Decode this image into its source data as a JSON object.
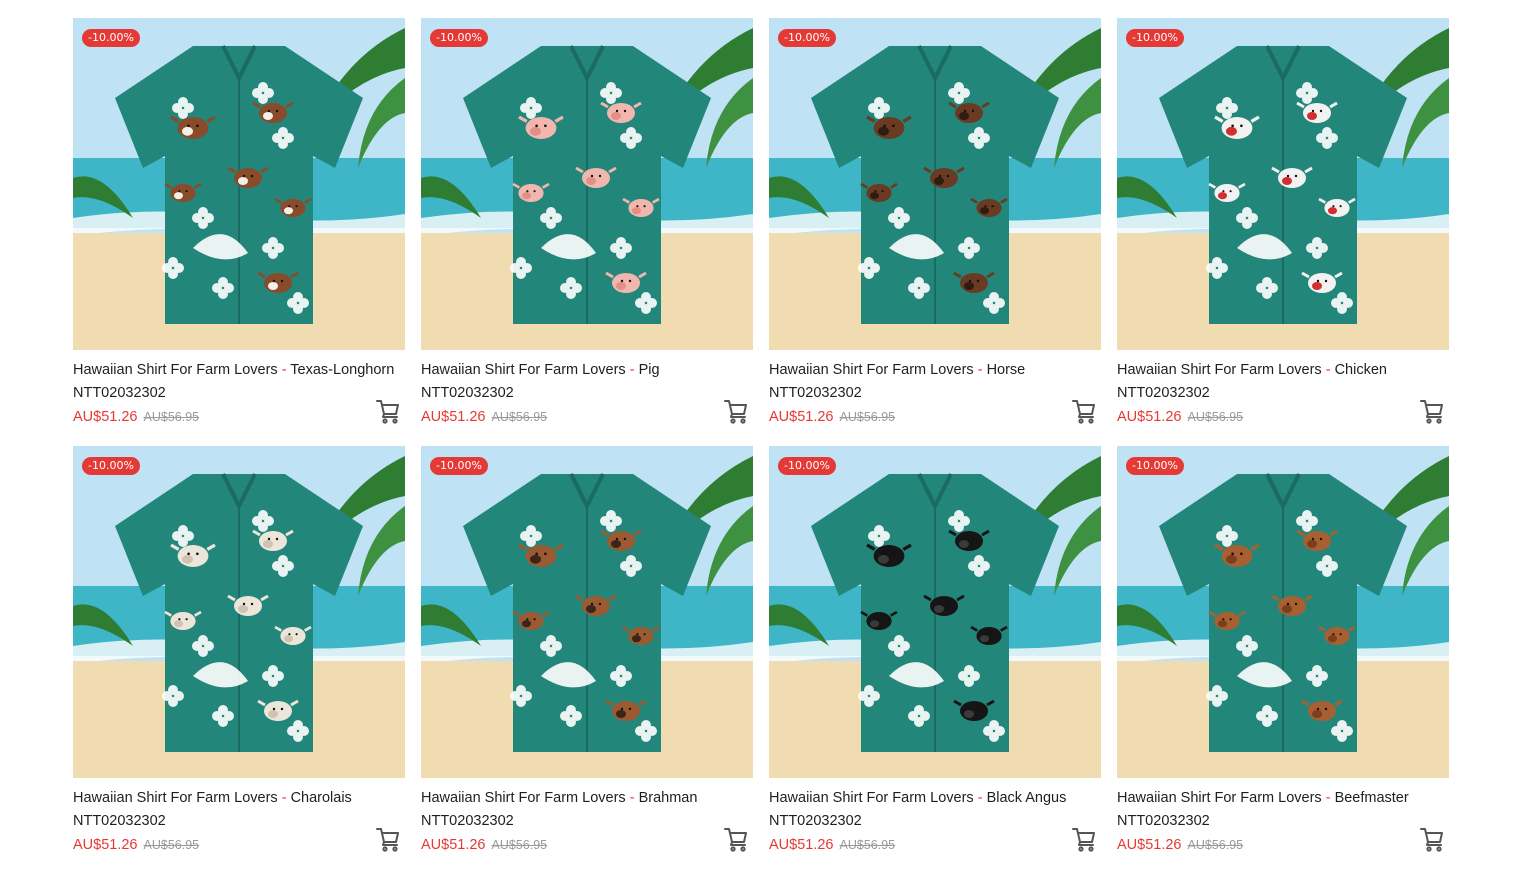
{
  "products": [
    {
      "name": "Hawaiian Shirt For Farm Lovers",
      "variant": "Texas-Longhorn",
      "sku": "NTT02032302",
      "price": "AU$51.26",
      "old_price": "AU$56.95",
      "discount": "-10.00%",
      "animal_color": "#8a4b2a",
      "animal_accent": "#f3efe9"
    },
    {
      "name": "Hawaiian Shirt For Farm Lovers",
      "variant": "Pig",
      "sku": "NTT02032302",
      "price": "AU$51.26",
      "old_price": "AU$56.95",
      "discount": "-10.00%",
      "animal_color": "#f1b7ae",
      "animal_accent": "#e38f86"
    },
    {
      "name": "Hawaiian Shirt For Farm Lovers",
      "variant": "Horse",
      "sku": "NTT02032302",
      "price": "AU$51.26",
      "old_price": "AU$56.95",
      "discount": "-10.00%",
      "animal_color": "#6a3a22",
      "animal_accent": "#2e1b12"
    },
    {
      "name": "Hawaiian Shirt For Farm Lovers",
      "variant": "Chicken",
      "sku": "NTT02032302",
      "price": "AU$51.26",
      "old_price": "AU$56.95",
      "discount": "-10.00%",
      "animal_color": "#f2f2f2",
      "animal_accent": "#d32f2f"
    },
    {
      "name": "Hawaiian Shirt For Farm Lovers",
      "variant": "Charolais",
      "sku": "NTT02032302",
      "price": "AU$51.26",
      "old_price": "AU$56.95",
      "discount": "-10.00%",
      "animal_color": "#ece6da",
      "animal_accent": "#cfc4b2"
    },
    {
      "name": "Hawaiian Shirt For Farm Lovers",
      "variant": "Brahman",
      "sku": "NTT02032302",
      "price": "AU$51.26",
      "old_price": "AU$56.95",
      "discount": "-10.00%",
      "animal_color": "#9c5a32",
      "animal_accent": "#3b2418"
    },
    {
      "name": "Hawaiian Shirt For Farm Lovers",
      "variant": "Black Angus",
      "sku": "NTT02032302",
      "price": "AU$51.26",
      "old_price": "AU$56.95",
      "discount": "-10.00%",
      "animal_color": "#151515",
      "animal_accent": "#3a3a3a"
    },
    {
      "name": "Hawaiian Shirt For Farm Lovers",
      "variant": "Beefmaster",
      "sku": "NTT02032302",
      "price": "AU$51.26",
      "old_price": "AU$56.95",
      "discount": "-10.00%",
      "animal_color": "#a85f32",
      "animal_accent": "#7a3f1c"
    }
  ],
  "icons": {
    "cart": "shopping-cart-icon"
  },
  "colors": {
    "shirt": "#23867a",
    "sale": "#e53935",
    "sky": "#bfe3f5",
    "sea": "#3fb6c8",
    "sand": "#f0dcb0",
    "palm": "#2e7d32"
  }
}
